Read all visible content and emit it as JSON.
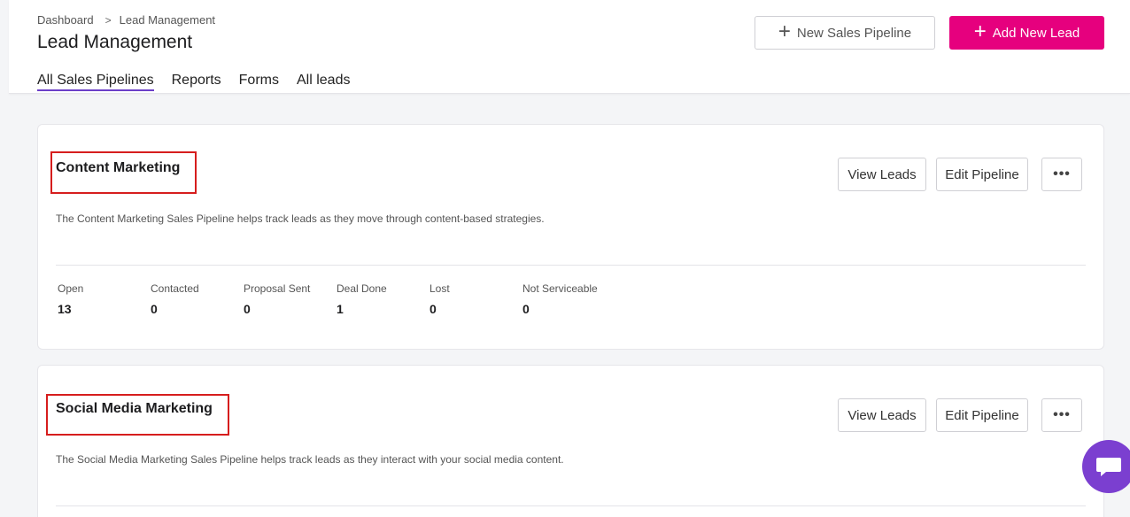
{
  "breadcrumb": {
    "items": [
      "Dashboard",
      "Lead Management"
    ],
    "separator": ">"
  },
  "page": {
    "title": "Lead Management"
  },
  "header_buttons": {
    "new_pipeline": "New Sales Pipeline",
    "add_lead": "Add New Lead"
  },
  "tabs": [
    {
      "label": "All Sales Pipelines",
      "active": true
    },
    {
      "label": "Reports",
      "active": false
    },
    {
      "label": "Forms",
      "active": false
    },
    {
      "label": "All leads",
      "active": false
    }
  ],
  "pipelines": [
    {
      "title": "Content Marketing",
      "description": "The Content Marketing Sales Pipeline helps track leads as they move through content-based strategies.",
      "view_label": "View Leads",
      "edit_label": "Edit Pipeline",
      "more_label": "•••",
      "stats": [
        {
          "label": "Open",
          "value": "13"
        },
        {
          "label": "Contacted",
          "value": "0"
        },
        {
          "label": "Proposal Sent",
          "value": "0"
        },
        {
          "label": "Deal Done",
          "value": "1"
        },
        {
          "label": "Lost",
          "value": "0"
        },
        {
          "label": "Not Serviceable",
          "value": "0"
        }
      ]
    },
    {
      "title": "Social Media Marketing",
      "description": "The Social Media Marketing Sales Pipeline helps track leads as they interact with your social media content.",
      "view_label": "View Leads",
      "edit_label": "Edit Pipeline",
      "more_label": "•••"
    }
  ],
  "colors": {
    "primary": "#e6007e",
    "tab_underline": "#6c3fc8",
    "highlight": "#d61d1d",
    "chat": "#7b3fd0"
  },
  "icons": {
    "plus": "plus-icon",
    "chevron": "chevron-right-icon",
    "chat": "chat-icon"
  }
}
